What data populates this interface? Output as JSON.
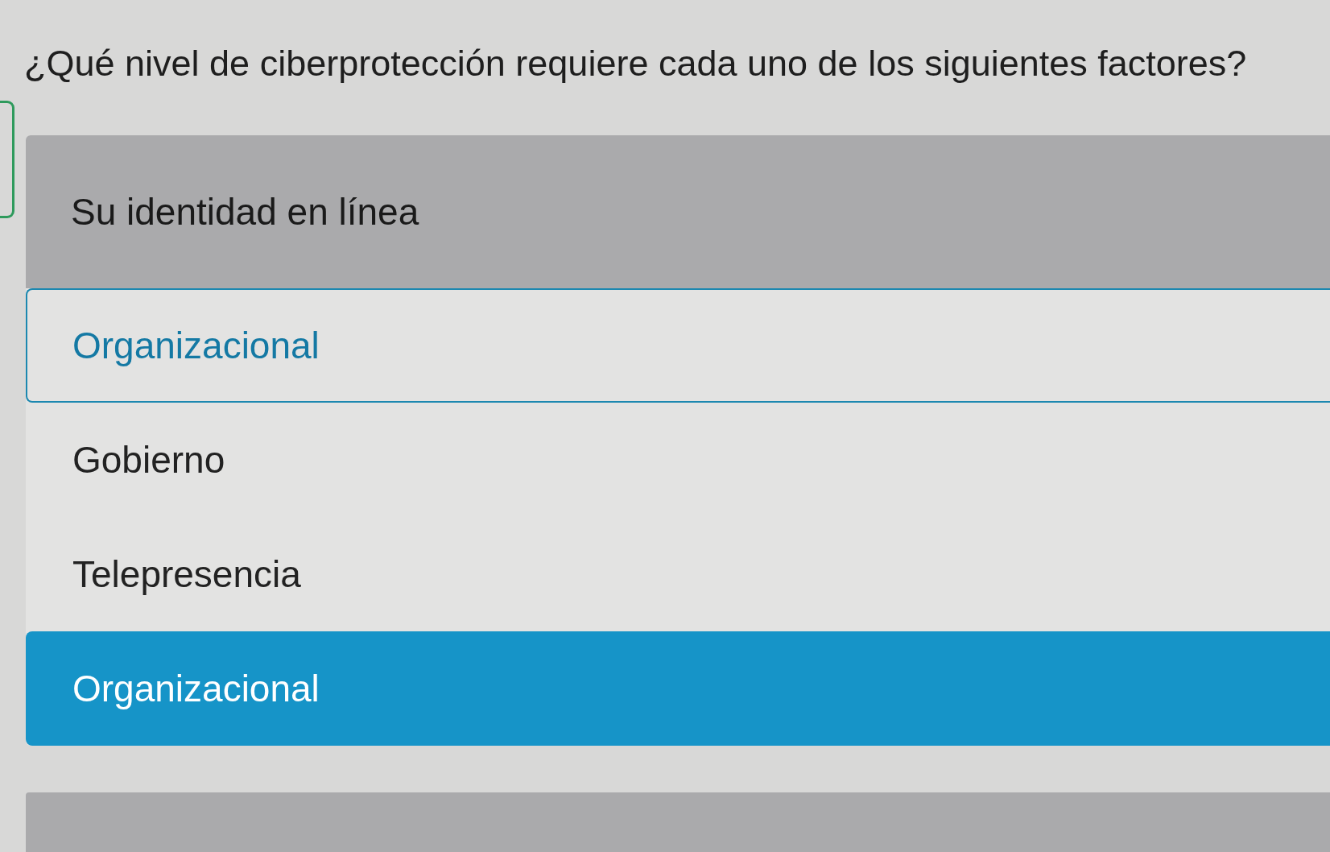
{
  "question": "¿Qué nivel de ciberprotección requiere cada uno de los siguientes factores?",
  "factor": {
    "label": "Su identidad en línea",
    "options": [
      {
        "label": "Organizacional",
        "focused": true,
        "selected": false
      },
      {
        "label": "Gobierno",
        "focused": false,
        "selected": false
      },
      {
        "label": "Telepresencia",
        "focused": false,
        "selected": false
      },
      {
        "label": "Organizacional",
        "focused": false,
        "selected": true
      }
    ]
  }
}
